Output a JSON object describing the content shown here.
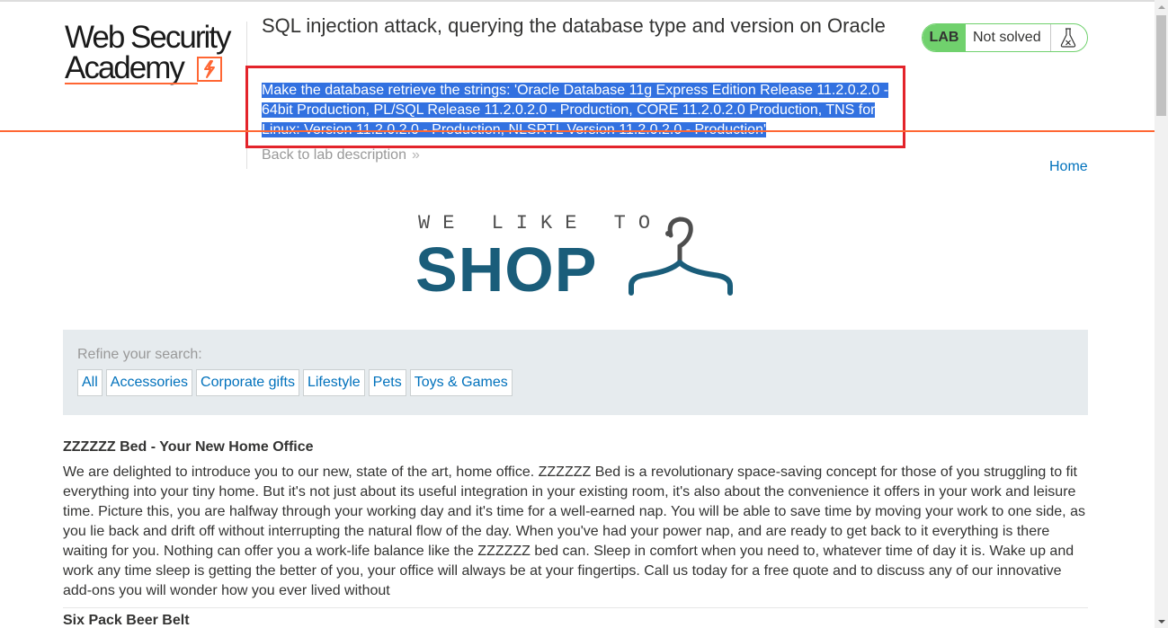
{
  "header": {
    "logo_line1": "Web Security",
    "logo_line2": "Academy",
    "lab_title": "SQL injection attack, querying the database type and version on Oracle",
    "objective": "Make the database retrieve the strings: 'Oracle Database 11g Express Edition Release 11.2.0.2.0 - 64bit Production, PL/SQL Release 11.2.0.2.0 - Production, CORE 11.2.0.2.0 Production, TNS for Linux: Version 11.2.0.2.0 - Production, NLSRTL Version 11.2.0.2.0 - Production'",
    "back_link": "Back to lab description",
    "back_chevron": "»"
  },
  "status": {
    "badge": "LAB",
    "text": "Not solved",
    "icon": "flask-icon"
  },
  "nav": {
    "home": "Home"
  },
  "shop": {
    "tagline": "WE LIKE TO",
    "word": "SHOP",
    "icon": "hanger-icon"
  },
  "filter": {
    "label": "Refine your search:",
    "categories": [
      "All",
      "Accessories",
      "Corporate gifts",
      "Lifestyle",
      "Pets",
      "Toys & Games"
    ]
  },
  "posts": [
    {
      "title": "ZZZZZZ Bed - Your New Home Office",
      "body": "We are delighted to introduce you to our new, state of the art, home office. ZZZZZZ Bed is a revolutionary space-saving concept for those of you struggling to fit everything into your tiny home. But it's not just about its useful integration in your existing room, it's also about the convenience it offers in your work and leisure time. Picture this, you are halfway through your working day and it's time for a well-earned nap. You will be able to save time by moving your work to one side, as you lie back and drift off without interrupting the natural flow of the day. When you've had your power nap, and are ready to get back to it everything is there waiting for you. Nothing can offer you a work-life balance like the ZZZZZZ bed can. Sleep in comfort when you need to, whatever time of day it is. Wake up and work any time sleep is getting the better of you, your office will always be at your fingertips. Call us today for a free quote and to discuss any of our innovative add-ons you will wonder how you ever lived without"
    },
    {
      "title": "Six Pack Beer Belt"
    }
  ],
  "colors": {
    "accent_orange": "#ff6633",
    "lab_green": "#70d16d",
    "link_blue": "#0071bc",
    "shop_blue": "#1a5d7a",
    "highlight_red": "#e3242b",
    "selection_blue": "#3271e0"
  }
}
